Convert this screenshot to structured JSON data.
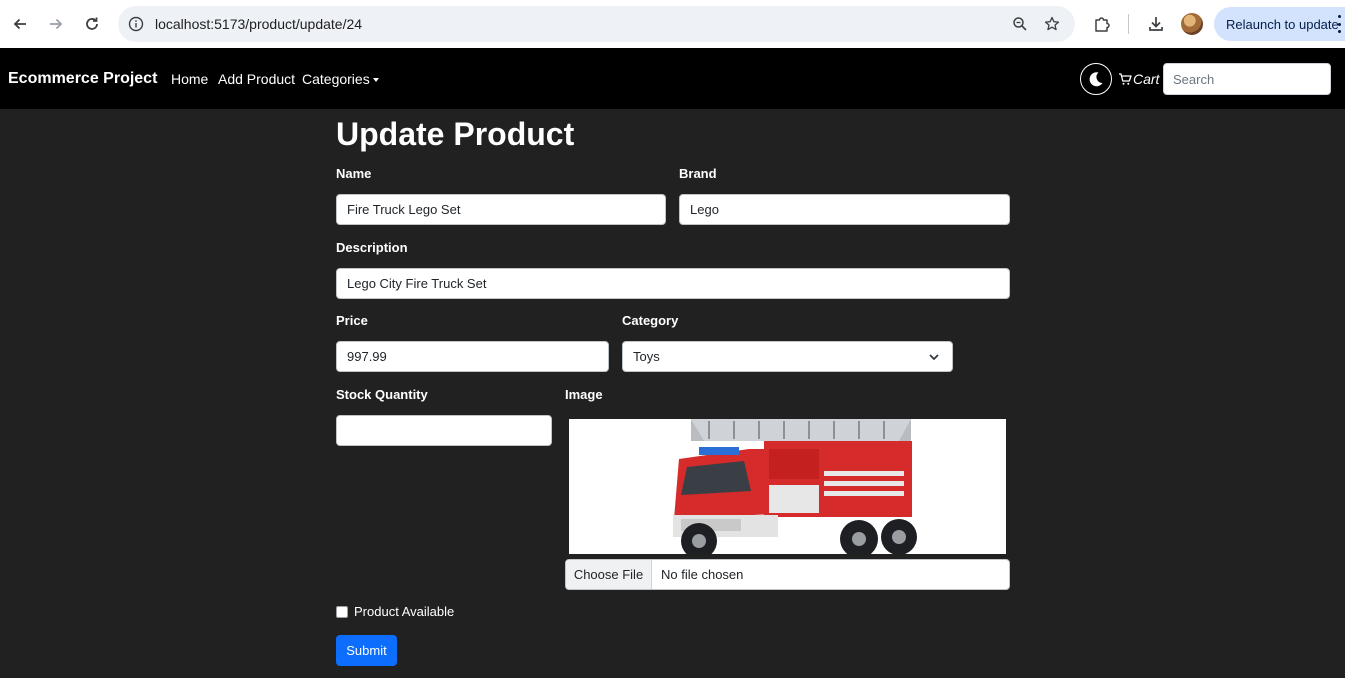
{
  "browser": {
    "url": "localhost:5173/product/update/24",
    "relaunch_label": "Relaunch to update"
  },
  "navbar": {
    "brand": "Ecommerce Project",
    "links": [
      "Home",
      "Add Product",
      "Categories"
    ],
    "cart_label": "Cart",
    "search_placeholder": "Search"
  },
  "form": {
    "title": "Update Product",
    "name_label": "Name",
    "name_value": "Fire Truck Lego Set",
    "brand_label": "Brand",
    "brand_value": "Lego",
    "description_label": "Description",
    "description_value": "Lego City Fire Truck Set",
    "price_label": "Price",
    "price_value": "997.99",
    "category_label": "Category",
    "category_value": "Toys",
    "stock_label": "Stock Quantity",
    "stock_value": "",
    "image_label": "Image",
    "file_button": "Choose File",
    "file_status": "No file chosen",
    "available_label": "Product Available",
    "available_checked": false,
    "submit_label": "Submit"
  },
  "colors": {
    "page_bg": "#212121",
    "navbar_bg": "#000000",
    "primary": "#0d6efd"
  }
}
